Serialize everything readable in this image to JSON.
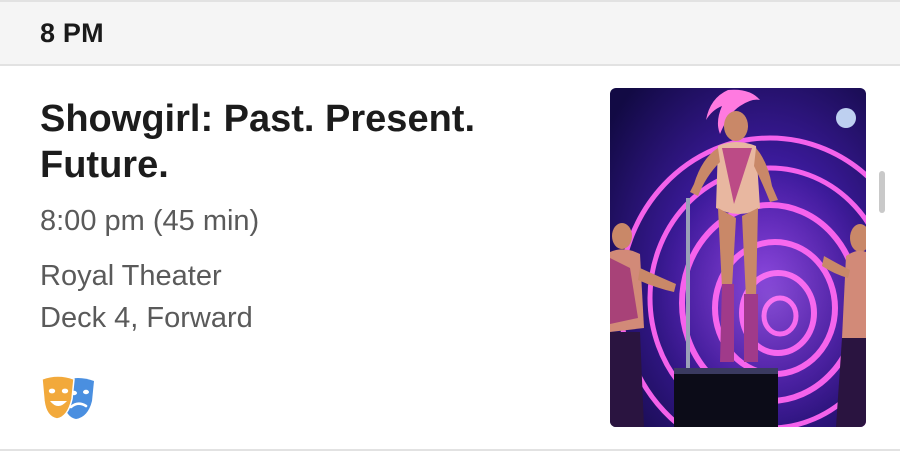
{
  "time_header": {
    "label": "8 PM"
  },
  "event": {
    "title": "Showgirl: Past. Present. Future.",
    "time": "8:00 pm (45 min)",
    "venue_name": "Royal Theater",
    "venue_location": "Deck 4, Forward",
    "category_icon": "theater-masks-icon",
    "image": "showgirl-performer-photo"
  },
  "colors": {
    "header_background": "#f5f5f5",
    "title_text": "#1c1c1c",
    "secondary_text": "#5a5a5a",
    "mask_orange": "#f2a93b",
    "mask_blue": "#4a8fe0"
  }
}
